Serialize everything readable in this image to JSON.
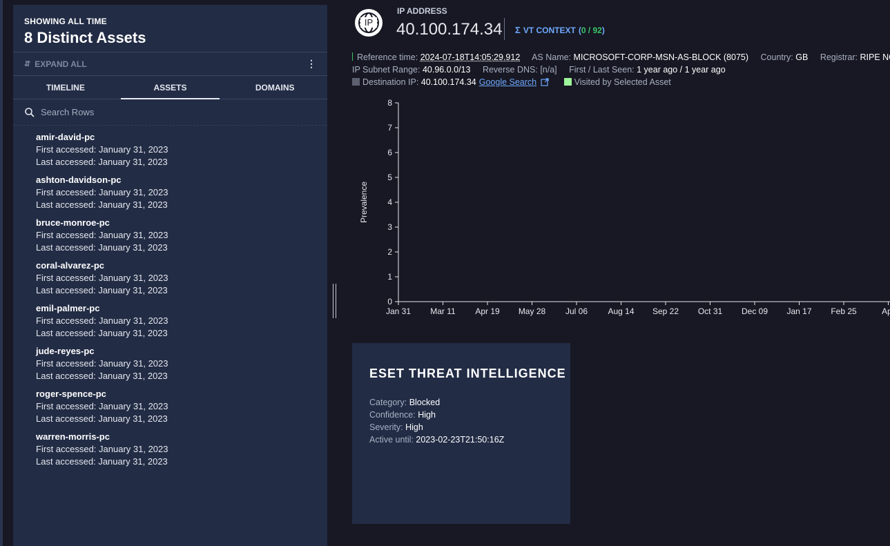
{
  "panel": {
    "showing": "SHOWING ALL TIME",
    "count_title": "8 Distinct Assets",
    "expand_all": "EXPAND ALL",
    "tabs": [
      {
        "label": "TIMELINE",
        "active": false
      },
      {
        "label": "ASSETS",
        "active": true
      },
      {
        "label": "DOMAINS",
        "active": false
      }
    ],
    "search_placeholder": "Search Rows",
    "assets": [
      {
        "name": "amir-david-pc",
        "first": "First accessed: January 31, 2023",
        "last": "Last accessed: January 31, 2023"
      },
      {
        "name": "ashton-davidson-pc",
        "first": "First accessed: January 31, 2023",
        "last": "Last accessed: January 31, 2023"
      },
      {
        "name": "bruce-monroe-pc",
        "first": "First accessed: January 31, 2023",
        "last": "Last accessed: January 31, 2023"
      },
      {
        "name": "coral-alvarez-pc",
        "first": "First accessed: January 31, 2023",
        "last": "Last accessed: January 31, 2023"
      },
      {
        "name": "emil-palmer-pc",
        "first": "First accessed: January 31, 2023",
        "last": "Last accessed: January 31, 2023"
      },
      {
        "name": "jude-reyes-pc",
        "first": "First accessed: January 31, 2023",
        "last": "Last accessed: January 31, 2023"
      },
      {
        "name": "roger-spence-pc",
        "first": "First accessed: January 31, 2023",
        "last": "Last accessed: January 31, 2023"
      },
      {
        "name": "warren-morris-pc",
        "first": "First accessed: January 31, 2023",
        "last": "Last accessed: January 31, 2023"
      }
    ]
  },
  "header": {
    "icon_text": "IP",
    "label": "IP ADDRESS",
    "ip": "40.100.174.34",
    "vt_label": "VT CONTEXT",
    "vt_open": "(",
    "vt_ratio": "0 / 92",
    "vt_close": ")"
  },
  "meta": {
    "ref_time_label": "Reference time:",
    "ref_time": "2024-07-18T14:05:29.912",
    "as_name_label": "AS Name:",
    "as_name": "MICROSOFT-CORP-MSN-AS-BLOCK (8075)",
    "country_label": "Country:",
    "country": "GB",
    "registrar_label": "Registrar:",
    "registrar": "RIPE NCC",
    "subnet_label": "IP Subnet Range:",
    "subnet": "40.96.0.0/13",
    "rdns_label": "Reverse DNS:",
    "rdns": "[n/a]",
    "seen_label": "First / Last Seen:",
    "seen": "1 year ago / 1 year ago",
    "dest_label": "Destination IP:",
    "dest": "40.100.174.34",
    "google": "Google Search",
    "visited_label": "Visited by Selected Asset"
  },
  "chart_data": {
    "type": "bar",
    "ylabel": "Prevalence",
    "xlabel": "",
    "ylim": [
      0,
      8
    ],
    "yticks": [
      0,
      1,
      2,
      3,
      4,
      5,
      6,
      7,
      8
    ],
    "categories": [
      "Jan 31",
      "Mar 11",
      "Apr 19",
      "May 28",
      "Jul 06",
      "Aug 14",
      "Sep 22",
      "Oct 31",
      "Dec 09",
      "Jan 17",
      "Feb 25",
      "Apr"
    ],
    "values": [],
    "colors": {
      "axis": "#e6e8ee",
      "visited": "#9ef59b"
    }
  },
  "eset": {
    "title": "ESET THREAT INTELLIGENCE",
    "category_label": "Category:",
    "category": "Blocked",
    "confidence_label": "Confidence:",
    "confidence": "High",
    "severity_label": "Severity:",
    "severity": "High",
    "active_label": "Active until:",
    "active": "2023-02-23T21:50:16Z"
  }
}
